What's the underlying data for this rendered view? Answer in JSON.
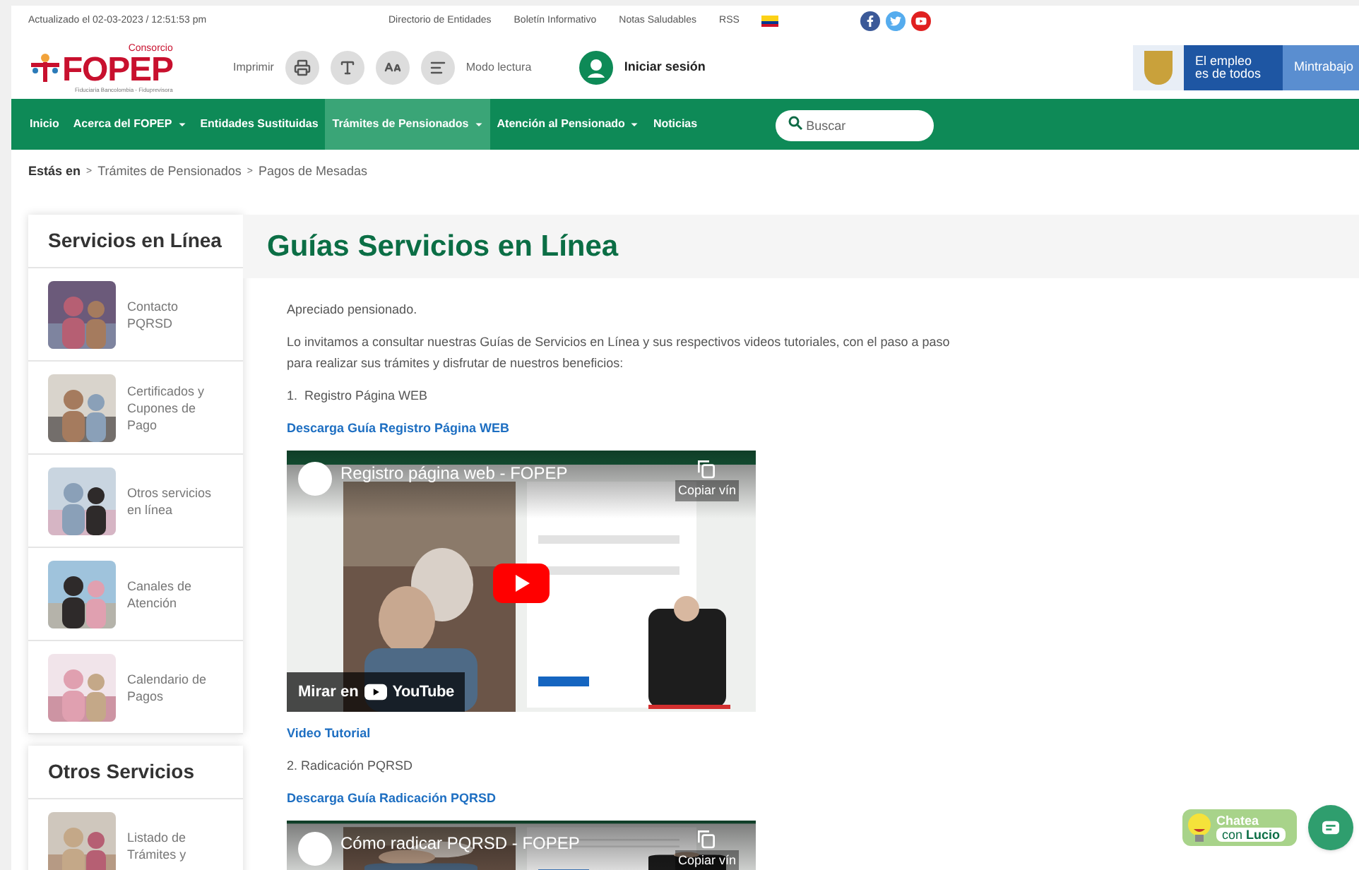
{
  "top_bar": {
    "updated": "Actualizado el 02-03-2023 / 12:51:53 pm",
    "links": [
      "Directorio de Entidades",
      "Boletín Informativo",
      "Notas Saludables",
      "RSS"
    ]
  },
  "header": {
    "logo": {
      "top": "Consorcio",
      "name": "FOPEP",
      "sub": "Fiduciaria Bancolombia - Fiduprevisora"
    },
    "print_label": "Imprimir",
    "reading_mode": "Modo lectura",
    "login": "Iniciar sesión",
    "gov_badge": [
      "El empleo",
      "es de todos"
    ],
    "ministry": "Mintrabajo"
  },
  "nav": {
    "items": [
      {
        "label": "Inicio",
        "dropdown": false,
        "selected": false
      },
      {
        "label": "Acerca del FOPEP",
        "dropdown": true,
        "selected": false
      },
      {
        "label": "Entidades Sustituidas",
        "dropdown": false,
        "selected": false
      },
      {
        "label": "Trámites de Pensionados",
        "dropdown": true,
        "selected": true
      },
      {
        "label": "Atención al Pensionado",
        "dropdown": true,
        "selected": false
      },
      {
        "label": "Noticias",
        "dropdown": false,
        "selected": false
      }
    ],
    "search": {
      "placeholder": "Buscar"
    }
  },
  "breadcrumb": {
    "lead": "Estás en",
    "separator": ">",
    "items": [
      "Trámites de Pensionados",
      "Pagos de Mesadas"
    ]
  },
  "sidebar": [
    {
      "title": "Servicios en Línea",
      "items": [
        {
          "label": "Contacto PQRSD"
        },
        {
          "label": "Certificados y Cupones de Pago"
        },
        {
          "label": "Otros servicios en línea"
        },
        {
          "label": "Canales de Atención"
        },
        {
          "label": "Calendario de Pagos"
        }
      ]
    },
    {
      "title": "Otros Servicios",
      "items": [
        {
          "label": "Listado de Trámites y"
        }
      ]
    }
  ],
  "main": {
    "title": "Guías Servicios en Línea",
    "blocks": [
      {
        "kind": "text",
        "text": "Apreciado pensionado."
      },
      {
        "kind": "text",
        "text": "Lo invitamos a consultar nuestras Guías de Servicios en Línea y sus respectivos videos tutoriales, con el paso a paso para realizar sus trámites y disfrutar de nuestros beneficios:"
      },
      {
        "kind": "text",
        "text": "1.  Registro Página WEB"
      },
      {
        "kind": "link",
        "text": "Descarga Guía Registro Página WEB"
      },
      {
        "kind": "video",
        "title": "Registro página web - FOPEP",
        "copy": "Copiar vín",
        "watch": "Mirar en",
        "platform": "YouTube",
        "full": true
      },
      {
        "kind": "link",
        "text": "Video Tutorial"
      },
      {
        "kind": "text",
        "text": "2. Radicación PQRSD"
      },
      {
        "kind": "link",
        "text": "Descarga Guía Radicación PQRSD"
      },
      {
        "kind": "video",
        "title": "Cómo radicar PQRSD - FOPEP",
        "copy": "Copiar vín",
        "full": false
      }
    ]
  },
  "chat": {
    "line1": "Chatea",
    "line2_a": "con",
    "line2_b": "Lucio"
  }
}
